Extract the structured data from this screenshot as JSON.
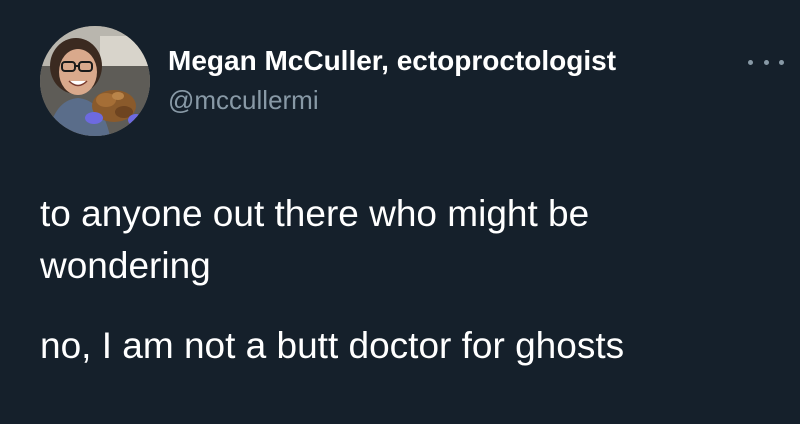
{
  "tweet": {
    "author": {
      "display_name": "Megan McCuller, ectoproctologist",
      "handle": "@mccullermi"
    },
    "paragraphs": [
      "to anyone out there who might be wondering",
      "no, I am not a butt doctor for ghosts"
    ]
  },
  "icons": {
    "more": "more-options-icon",
    "avatar": "profile-photo"
  },
  "colors": {
    "background": "#15202b",
    "text": "#ffffff",
    "secondary_text": "#8899a6"
  }
}
